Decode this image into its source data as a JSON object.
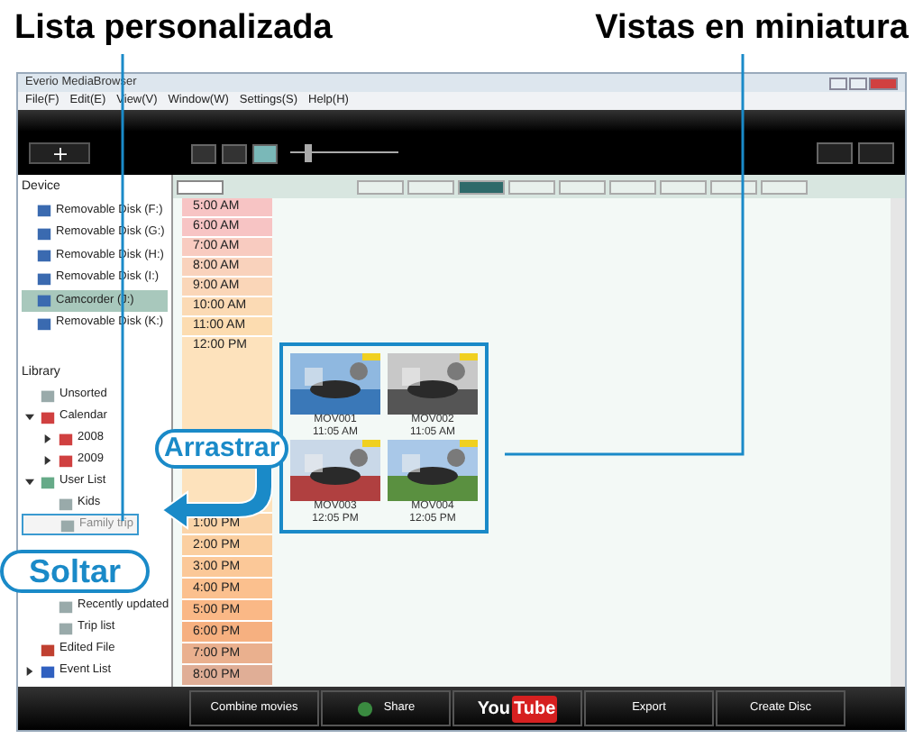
{
  "annotations": {
    "left_title": "Lista personalizada",
    "right_title": "Vistas en miniatura",
    "drag": "Arrastrar",
    "drop": "Soltar"
  },
  "window": {
    "title": "Everio MediaBrowser"
  },
  "menu": [
    "File(F)",
    "Edit(E)",
    "View(V)",
    "Window(W)",
    "Settings(S)",
    "Help(H)"
  ],
  "toolbar": {
    "view_modes": [
      {
        "selected": false
      },
      {
        "selected": false
      },
      {
        "selected": true
      }
    ],
    "zoom": {
      "level": 0.15
    }
  },
  "date_bar": [
    {
      "selected": false
    },
    {
      "selected": false
    },
    {
      "selected": true
    },
    {
      "selected": false
    },
    {
      "selected": false
    },
    {
      "selected": false
    },
    {
      "selected": false
    },
    {
      "selected": false
    },
    {
      "selected": false
    }
  ],
  "sidebar": {
    "device": {
      "title": "Device",
      "items": [
        {
          "label": "Removable Disk (F:)",
          "selected": false
        },
        {
          "label": "Removable Disk (G:)",
          "selected": false
        },
        {
          "label": "Removable Disk (H:)",
          "selected": false
        },
        {
          "label": "Removable Disk (I:)",
          "selected": false
        },
        {
          "label": "Camcorder (J:)",
          "selected": true
        },
        {
          "label": "Removable Disk (K:)",
          "selected": false
        }
      ]
    },
    "library": {
      "title": "Library",
      "items": [
        {
          "label": "Unsorted",
          "kind": "folder"
        },
        {
          "label": "Calendar",
          "kind": "calendar",
          "expanded": true,
          "children": [
            {
              "label": "2008",
              "kind": "calendar",
              "expanded": false
            },
            {
              "label": "2009",
              "kind": "calendar",
              "expanded": false
            }
          ]
        },
        {
          "label": "User List",
          "kind": "list",
          "expanded": true,
          "children": [
            {
              "label": "Kids",
              "kind": "folder"
            },
            {
              "label": "Family trip",
              "kind": "folder",
              "selected": true
            }
          ]
        },
        {
          "kind": "covered",
          "children": [
            {
              "label": "Recently updated",
              "kind": "folder"
            },
            {
              "label": "Trip list",
              "kind": "folder"
            }
          ]
        },
        {
          "label": "Edited File",
          "kind": "edited"
        },
        {
          "label": "Event List",
          "kind": "event",
          "expanded": false
        }
      ]
    }
  },
  "timeline": {
    "hours": [
      {
        "label": "5:00 AM",
        "color": "#f7c4c4"
      },
      {
        "label": "6:00 AM",
        "color": "#f7c4c4"
      },
      {
        "label": "7:00 AM",
        "color": "#f8cbc0"
      },
      {
        "label": "8:00 AM",
        "color": "#f9d2bc"
      },
      {
        "label": "9:00 AM",
        "color": "#fad6b8"
      },
      {
        "label": "10:00 AM",
        "color": "#fbdab4"
      },
      {
        "label": "11:00 AM",
        "color": "#fcdcb0"
      },
      {
        "label": "12:00 PM",
        "color": "#fde2bc",
        "tall": true
      },
      {
        "label": "1:00 PM",
        "color": "#fbd4a8"
      },
      {
        "label": "2:00 PM",
        "color": "#fbcfa0"
      },
      {
        "label": "3:00 PM",
        "color": "#fbc898"
      },
      {
        "label": "4:00 PM",
        "color": "#fbc08e"
      },
      {
        "label": "5:00 PM",
        "color": "#fab886"
      },
      {
        "label": "6:00 PM",
        "color": "#f6b080"
      },
      {
        "label": "7:00 PM",
        "color": "#eab08e"
      },
      {
        "label": "8:00 PM",
        "color": "#e0ae96"
      }
    ]
  },
  "thumbnails": [
    {
      "name": "MOV001",
      "time": "11:05 AM",
      "kind": "sea"
    },
    {
      "name": "MOV002",
      "time": "11:05 AM",
      "kind": "street"
    },
    {
      "name": "MOV003",
      "time": "12:05 PM",
      "kind": "town"
    },
    {
      "name": "MOV004",
      "time": "12:05 PM",
      "kind": "hills"
    }
  ],
  "bottom_bar": [
    {
      "label": "Combine movies",
      "kind": "text"
    },
    {
      "label": "Share",
      "kind": "globe"
    },
    {
      "label": "You",
      "label2": "Tube",
      "kind": "logo"
    },
    {
      "label": "Export",
      "kind": "text"
    },
    {
      "label": "Create Disc",
      "kind": "text"
    }
  ]
}
